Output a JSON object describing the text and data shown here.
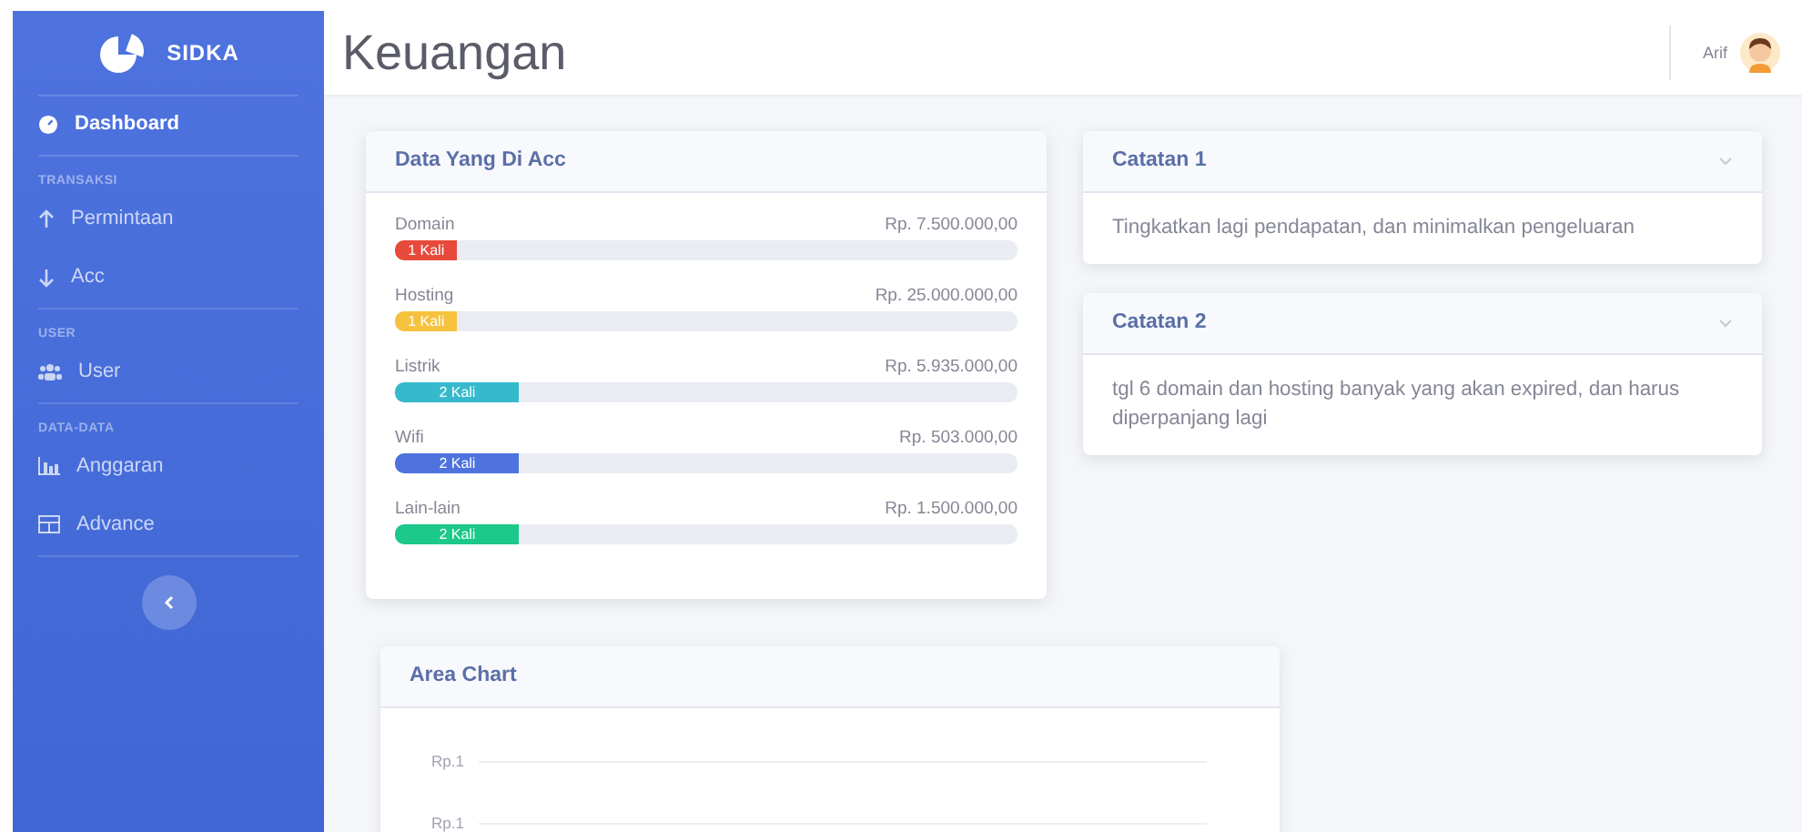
{
  "sidebar": {
    "brand": "SIDKA",
    "items": [
      {
        "kind": "link",
        "label": "Dashboard",
        "selected": true
      },
      {
        "kind": "heading",
        "label": "TRANSAKSI"
      },
      {
        "kind": "link",
        "label": "Permintaan",
        "selected": false
      },
      {
        "kind": "link",
        "label": "Acc",
        "selected": false
      },
      {
        "kind": "heading",
        "label": "USER"
      },
      {
        "kind": "link",
        "label": "User",
        "selected": false
      },
      {
        "kind": "heading",
        "label": "DATA-DATA"
      },
      {
        "kind": "link",
        "label": "Anggaran",
        "selected": false
      },
      {
        "kind": "link",
        "label": "Advance",
        "selected": false
      }
    ]
  },
  "topbar": {
    "title": "Keuangan",
    "user_name": "Arif"
  },
  "acc_card": {
    "title": "Data Yang Di Acc",
    "items": [
      {
        "name": "Domain",
        "amount": "Rp. 7.500.000,00",
        "count": "1 Kali",
        "level": 0.1,
        "color": "#e74a3b"
      },
      {
        "name": "Hosting",
        "amount": "Rp. 25.000.000,00",
        "count": "1 Kali",
        "level": 0.1,
        "color": "#f6c23e"
      },
      {
        "name": "Listrik",
        "amount": "Rp. 5.935.000,00",
        "count": "2 Kali",
        "level": 0.2,
        "color": "#36b9cc"
      },
      {
        "name": "Wifi",
        "amount": "Rp. 503.000,00",
        "count": "2 Kali",
        "level": 0.2,
        "color": "#4e73df"
      },
      {
        "name": "Lain-lain",
        "amount": "Rp. 1.500.000,00",
        "count": "2 Kali",
        "level": 0.2,
        "color": "#1cc88a"
      }
    ]
  },
  "notes": [
    {
      "title": "Catatan 1",
      "text": "Tingkatkan lagi pendapatan, dan minimalkan pengeluaran"
    },
    {
      "title": "Catatan 2",
      "text": "tgl 6 domain dan hosting banyak yang akan expired, dan harus diperpanjang lagi"
    }
  ],
  "area_chart": {
    "title": "Area Chart",
    "y_labels": [
      "Rp.1",
      "Rp.1"
    ]
  }
}
